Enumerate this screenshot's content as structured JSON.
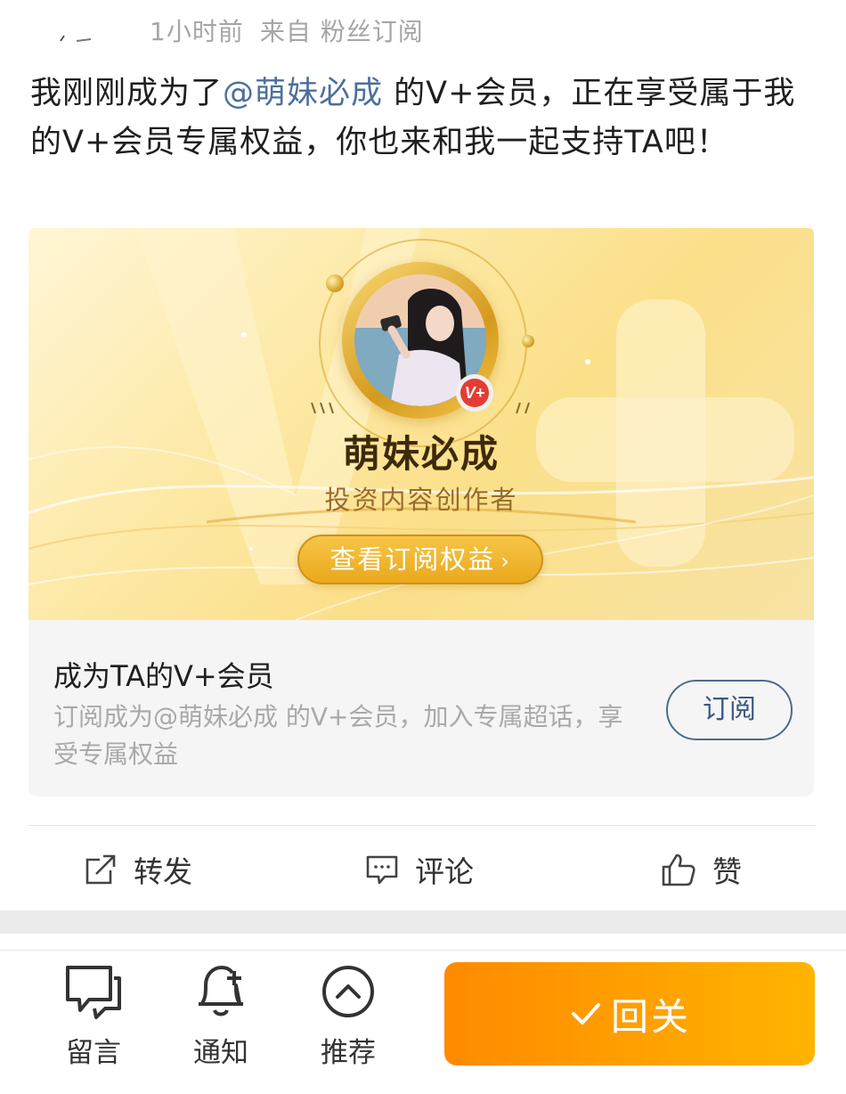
{
  "meta": {
    "time": "1小时前",
    "source": "来自 粉丝订阅"
  },
  "post": {
    "prefix": "我刚刚成为了",
    "mention": "@萌妹必成",
    "suffix": " 的V+会员，正在享受属于我的V+会员专属权益，你也来和我一起支持TA吧！"
  },
  "banner": {
    "badge_text": "V+",
    "creator_name": "萌妹必成",
    "creator_role": "投资内容创作者",
    "button_label": "查看订阅权益",
    "button_chevron": "›"
  },
  "subscribe": {
    "title": "成为TA的V+会员",
    "description": "订阅成为@萌妹必成 的V+会员，加入专属超话，享受专属权益",
    "button_label": "订阅"
  },
  "actions": {
    "repost": "转发",
    "comment": "评论",
    "like": "赞"
  },
  "toolbar": {
    "message": "留言",
    "notify": "通知",
    "recommend": "推荐",
    "follow": "回关"
  },
  "colors": {
    "accent_orange": "#ff8a00",
    "link_blue": "#4d6f9c",
    "gold": "#e9a91c",
    "badge_red": "#e43c34"
  }
}
